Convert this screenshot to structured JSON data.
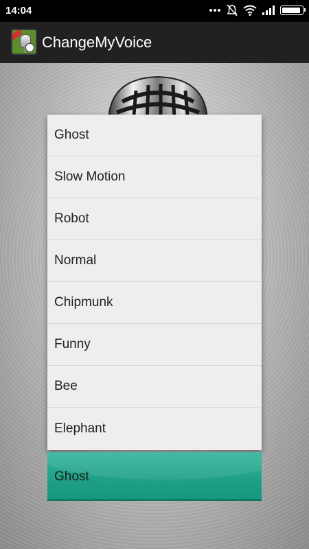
{
  "status_bar": {
    "time": "14:04",
    "icons": [
      "more-dots-icon",
      "silent-bell-icon",
      "wifi-icon",
      "signal-icon",
      "battery-icon"
    ]
  },
  "app_bar": {
    "title": "ChangeMyVoice",
    "icon": "microphone-app-icon"
  },
  "voice_options": [
    "Ghost",
    "Slow Motion",
    "Robot",
    "Normal",
    "Chipmunk",
    "Funny",
    "Bee",
    "Elephant"
  ],
  "selected_voice": "Ghost",
  "colors": {
    "accent": "#1f9f85",
    "app_bar": "#212121",
    "dropdown_bg": "#eeeeee"
  }
}
